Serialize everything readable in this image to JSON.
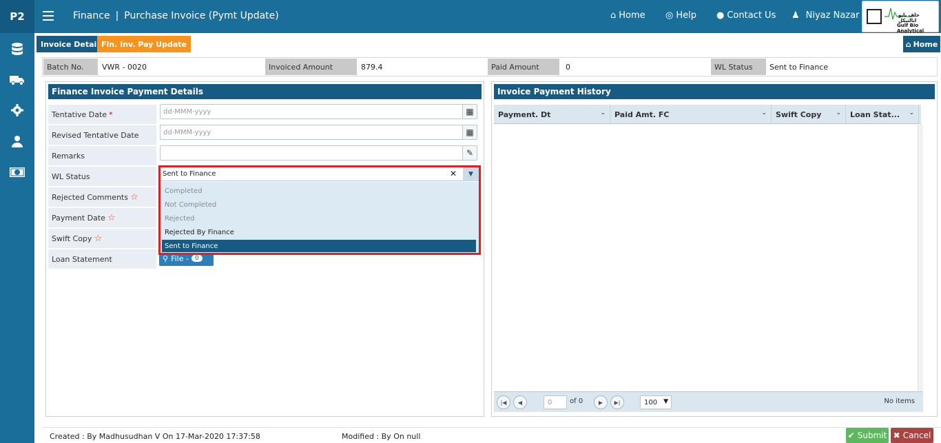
{
  "header": {
    "brand": "P2",
    "module": "Finance",
    "separator": "|",
    "page": "Purchase Invoice (Pymt Update)",
    "nav": {
      "home": "Home",
      "help": "Help",
      "contact": "Contact Us",
      "user": "Niyaz Nazar"
    },
    "logo": {
      "arabic": "جلف بايو انالتيكل",
      "english": "Gulf Bio Analytical"
    }
  },
  "tabs": {
    "invoice_details": "Invoice Details",
    "pay_update": "Fin. Inv. Pay Update",
    "home": "Home"
  },
  "summary": {
    "batch_label": "Batch No.",
    "batch_value": "VWR - 0020",
    "invoiced_label": "Invoiced Amount",
    "invoiced_value": "879.4",
    "paid_label": "Paid Amount",
    "paid_value": "0",
    "wl_label": "WL Status",
    "wl_value": "Sent to Finance"
  },
  "payment_panel": {
    "title": "Finance Invoice Payment Details",
    "tentative_date_label": "Tentative Date",
    "revised_date_label": "Revised Tentative Date",
    "remarks_label": "Remarks",
    "wl_status_label": "WL Status",
    "rejected_comments_label": "Rejected Comments",
    "payment_date_label": "Payment Date",
    "swift_copy_label": "Swift Copy",
    "loan_statement_label": "Loan Statement",
    "required_mark": "*",
    "star_mark": "☆",
    "date_placeholder": "dd-MMM-yyyy",
    "wl_status_value": "Sent to Finance",
    "wl_options": [
      "Completed",
      "Not Completed",
      "Rejected",
      "Rejected By Finance",
      "Sent to Finance"
    ],
    "file_label": "File -",
    "file_count": "0"
  },
  "history_panel": {
    "title": "Invoice Payment History",
    "columns": [
      "Payment. Dt",
      "Paid Amt. FC",
      "Swift Copy",
      "Loan Stat..."
    ],
    "page_value": "0",
    "of_label": "of 0",
    "page_size": "100",
    "no_items": "No items"
  },
  "footer": {
    "created": "Created : By Madhusudhan V On 17-Mar-2020 17:37:58",
    "modified": "Modified : By On null",
    "submit": "Submit",
    "cancel": "Cancel"
  },
  "colors": {
    "header": "#1a6e9a",
    "dark": "#185b82",
    "accent": "#f7941d",
    "highlight": "#e01e26",
    "submit": "#5cb85c",
    "cancel": "#a94442"
  }
}
